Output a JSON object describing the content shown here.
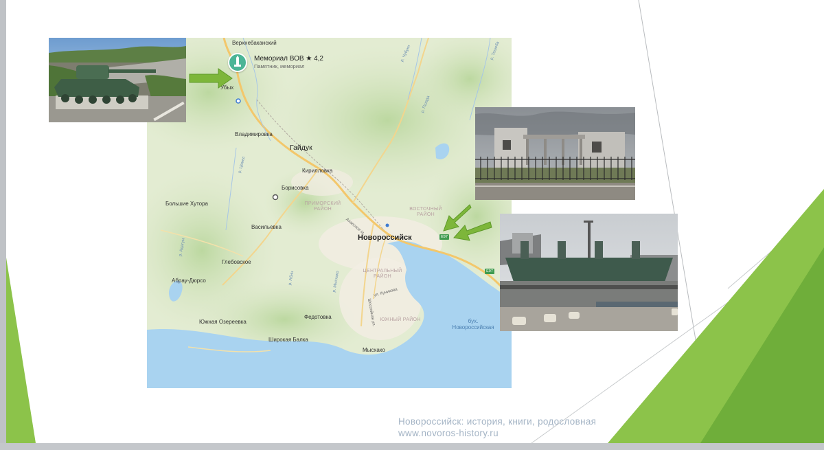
{
  "map": {
    "marker": {
      "title": "Мемориал ВОВ ★ 4,2",
      "subtitle": "Памятник, мемориал",
      "icon": "monument-icon"
    },
    "places": {
      "verkhnebakansky": "Верхнебаканский",
      "ubykh": "Убых",
      "vladimirovka": "Владимировка",
      "gaiduk": "Гайдук",
      "kirillovka": "Кирилловка",
      "borisovka": "Борисовка",
      "bolshie_khutora": "Большие Хутора",
      "vasilyevka": "Васильевка",
      "novorossiysk": "Новороссийск",
      "glebovskoe": "Глебовское",
      "abrau_dyurso": "Абрау-Дюрсо",
      "yuzhnaya_ozereevka": "Южная Озереевка",
      "fedotovka": "Федотовка",
      "shirokaya_balka": "Широкая Балка",
      "myskhako": "Мысхако"
    },
    "districts": {
      "primorsky": "ПРИМОРСКИЙ РАЙОН",
      "vostochny": "ВОСТОЧНЫЙ РАЙОН",
      "tsentralny": "ЦЕНТРАЛЬНЫЙ РАЙОН",
      "yuzhny": "ЮЖНЫЙ РАЙОН"
    },
    "water": {
      "bay": "бух. Новороссийская"
    },
    "streets": {
      "anapskoe": "Анапское ш.",
      "kunikova": "ул. Куникова",
      "shosseynaya": "Шоссейная ул."
    },
    "rivers": {
      "river_1": "р. Цемес",
      "river_2": "р. Адагум",
      "river_3": "р. Абин",
      "river_4": "р. Мысхако",
      "river_5": "р. Чубуки",
      "river_6": "р. Тешеба",
      "river_7": "р. Пшада"
    },
    "road_badges": [
      "E97",
      "E97"
    ]
  },
  "photos": {
    "tank": "tank-monument-photo",
    "ruins": "ruined-building-photo",
    "memorial": "memorial-monument-photo"
  },
  "footer": {
    "line1": "Новороссийск: история, книги, родословная",
    "line2": "www.novoros-history.ru"
  },
  "colors": {
    "accent_green": "#7cc242",
    "arrow_green": "#7db63a",
    "footer_text": "#a4b4c5",
    "marker": "#4bb596",
    "sea": "#a9d3f0"
  }
}
